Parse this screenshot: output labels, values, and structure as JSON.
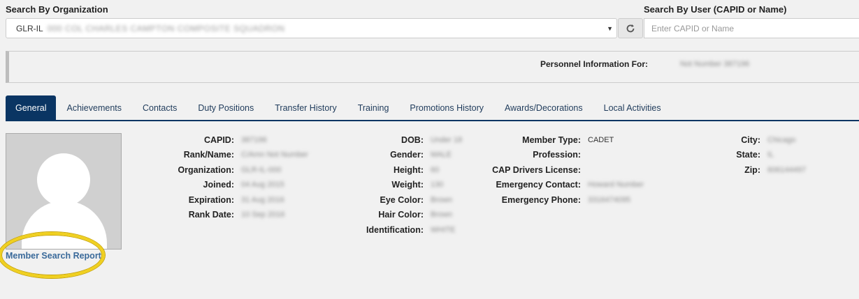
{
  "header": {
    "org_label": "Search By Organization",
    "user_label": "Search By User (CAPID or Name)"
  },
  "org_select": {
    "prefix": "GLR-IL",
    "value": "000 COL CHARLES CAMPTON COMPOSITE SQUADRON"
  },
  "user_search": {
    "placeholder": "Enter CAPID or Name"
  },
  "info_bar": {
    "label": "Personnel Information For:",
    "value": "Not Number 387196"
  },
  "tabs": [
    {
      "label": "General",
      "active": true
    },
    {
      "label": "Achievements"
    },
    {
      "label": "Contacts"
    },
    {
      "label": "Duty Positions"
    },
    {
      "label": "Transfer History"
    },
    {
      "label": "Training"
    },
    {
      "label": "Promotions History"
    },
    {
      "label": "Awards/Decorations"
    },
    {
      "label": "Local Activities"
    }
  ],
  "fields_col1": [
    {
      "label": "CAPID:",
      "value": "387196"
    },
    {
      "label": "Rank/Name:",
      "value": "C/Amn Not Number"
    },
    {
      "label": "Organization:",
      "value": "GLR-IL-000"
    },
    {
      "label": "Joined:",
      "value": "04 Aug 2015"
    },
    {
      "label": "Expiration:",
      "value": "31 Aug 2016"
    },
    {
      "label": "Rank Date:",
      "value": "10 Sep 2016"
    }
  ],
  "fields_col2": [
    {
      "label": "DOB:",
      "value": "Under 18"
    },
    {
      "label": "Gender:",
      "value": "MALE"
    },
    {
      "label": "Height:",
      "value": "60"
    },
    {
      "label": "Weight:",
      "value": "130"
    },
    {
      "label": "Eye Color:",
      "value": "Brown"
    },
    {
      "label": "Hair Color:",
      "value": "Brown"
    },
    {
      "label": "Identification:",
      "value": "WHITE"
    }
  ],
  "fields_col3": [
    {
      "label": "Member Type:",
      "value": "CADET",
      "clear": true
    },
    {
      "label": "Profession:",
      "value": ""
    },
    {
      "label": "CAP Drivers License:",
      "value": ""
    },
    {
      "label": "Emergency Contact:",
      "value": "Howard Number"
    },
    {
      "label": "Emergency Phone:",
      "value": "3316474095"
    }
  ],
  "fields_col4": [
    {
      "label": "City:",
      "value": "Chicago"
    },
    {
      "label": "State:",
      "value": "IL"
    },
    {
      "label": "Zip:",
      "value": "606144497"
    }
  ],
  "report_link": "Member Search Report",
  "colors": {
    "primary": "#0a3563",
    "highlight": "#f0d020",
    "link": "#3a6a9a"
  }
}
